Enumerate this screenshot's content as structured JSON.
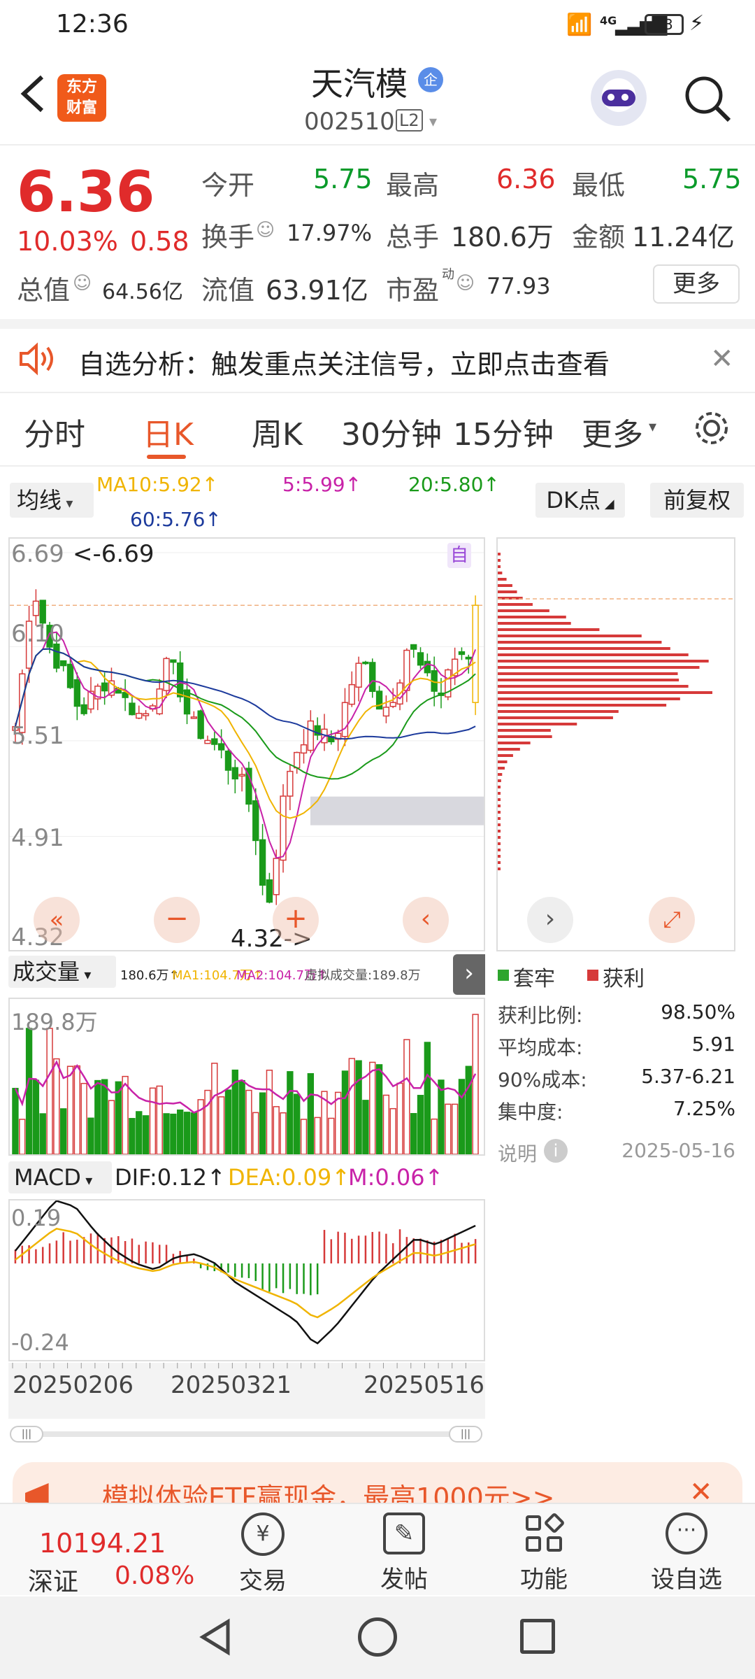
{
  "status": {
    "time": "12:36",
    "battery": "13",
    "net": "4G"
  },
  "header": {
    "name": "天汽模",
    "badge": "企",
    "code": "002510",
    "level": "L2",
    "logo_line1": "东方",
    "logo_line2": "财富"
  },
  "quote": {
    "price": "6.36",
    "pct": "10.03%",
    "chg": "0.58",
    "open_l": "今开",
    "open_v": "5.75",
    "high_l": "最高",
    "high_v": "6.36",
    "low_l": "最低",
    "low_v": "5.75",
    "turn_l": "换手",
    "turn_v": "17.97%",
    "vol_l": "总手",
    "vol_v": "180.6万",
    "amt_l": "金额",
    "amt_v": "11.24亿",
    "mcap_l": "总值",
    "mcap_v": "64.56亿",
    "float_l": "流值",
    "float_v": "63.91亿",
    "pe_l": "市盈",
    "pe_sup": "动",
    "pe_v": "77.93",
    "more": "更多"
  },
  "banner": {
    "text": "自选分析：触发重点关注信号，立即点击查看"
  },
  "tabs": [
    "分时",
    "日K",
    "周K",
    "30分钟",
    "15分钟",
    "更多"
  ],
  "ma_row": {
    "btn": "均线",
    "ma10": "MA10:5.92↑",
    "ma5": "5:5.99↑",
    "ma20": "20:5.80↑",
    "ma60": "60:5.76↑",
    "dk": "DK点",
    "fq": "前复权"
  },
  "kchart": {
    "y_top": "6.69",
    "y2": "6.10",
    "y3": "5.51",
    "y4": "4.91",
    "y_bot": "4.32",
    "max_ann": "<-6.69",
    "min_ann": "4.32->",
    "auto": "自"
  },
  "vol_row": {
    "btn": "成交量",
    "v": "180.6万↑",
    "ma1": "MA1:104.7万↑",
    "ma2": "MA2:104.7万↑",
    "virt": "虚拟成交量:189.8万",
    "ymax": "189.8万"
  },
  "macd_row": {
    "btn": "MACD",
    "dif": "DIF:0.12↑",
    "dea": "DEA:0.09↑",
    "m": "M:0.06↑",
    "ytop": "0.19",
    "ybot": "-0.24"
  },
  "dates": [
    "20250206",
    "20250321",
    "20250516"
  ],
  "chip": {
    "legend_a": "套牢",
    "legend_b": "获利",
    "rows": [
      {
        "label": "获利比例:",
        "value": "98.50%"
      },
      {
        "label": "平均成本:",
        "value": "5.91"
      },
      {
        "label": "90%成本:",
        "value": "5.37-6.21"
      },
      {
        "label": "集中度:",
        "value": "7.25%"
      }
    ],
    "note": "说明",
    "date": "2025-05-16"
  },
  "promo": {
    "text": "模拟体验ETF赢现金，最高1000元>>"
  },
  "bottom": {
    "index_value": "10194.21",
    "index_name": "深证",
    "index_pct": "0.08%",
    "items": [
      "交易",
      "发帖",
      "功能",
      "设自选"
    ]
  },
  "chart_data": {
    "type": "candlestick",
    "ylim": [
      4.32,
      6.69
    ],
    "close_last": 6.36,
    "ma": {
      "MA10": 5.92,
      "MA5": 5.99,
      "MA20": 5.8,
      "MA60": 5.76
    }
  }
}
